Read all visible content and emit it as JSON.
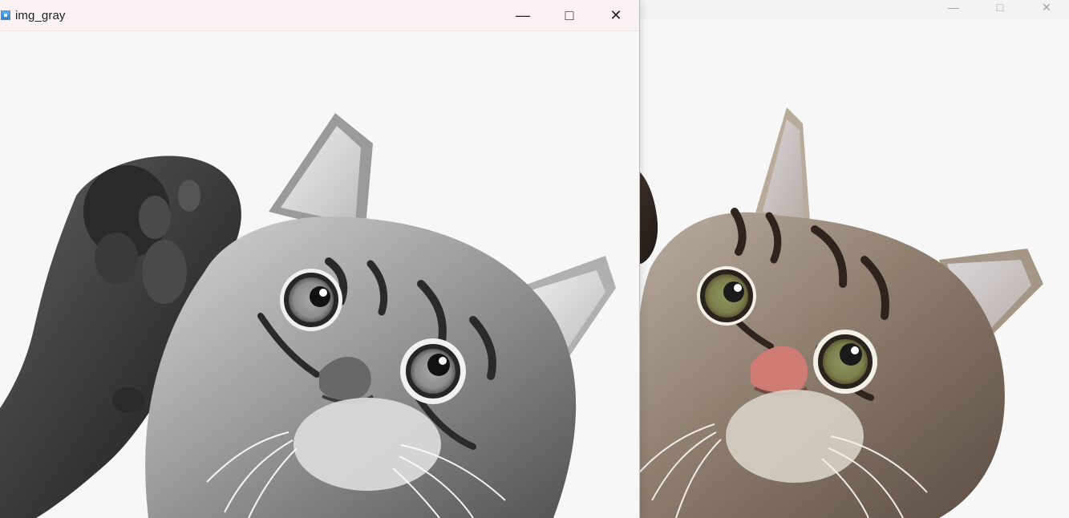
{
  "front_window": {
    "title": "img_gray",
    "controls": {
      "minimize": "—",
      "maximize": "□",
      "close": "✕"
    }
  },
  "back_window": {
    "controls": {
      "minimize": "—",
      "maximize": "□",
      "close": "✕"
    }
  },
  "colors": {
    "front_titlebar": "#faf2f2",
    "back_titlebar": "#f3f3f3",
    "canvas_background": "#f7f7f7"
  },
  "images": {
    "front_canvas": "grayscale-kitten-image",
    "back_canvas": "color-kitten-image"
  }
}
